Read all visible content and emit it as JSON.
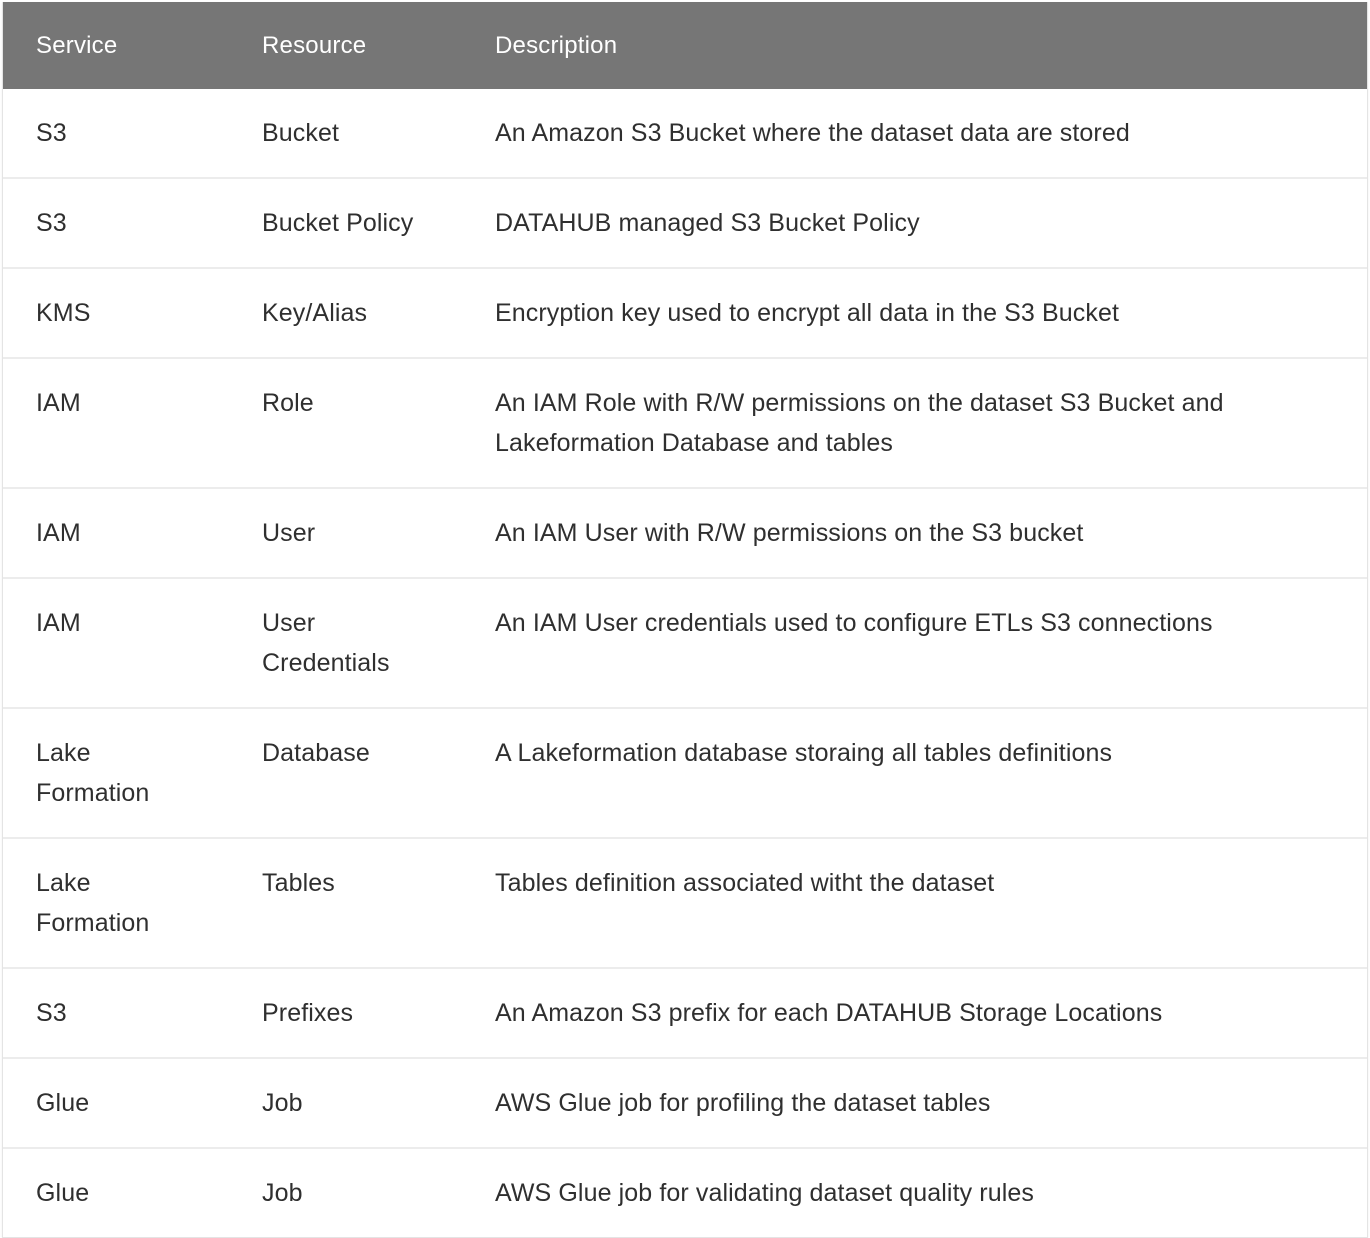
{
  "table": {
    "headers": {
      "service": "Service",
      "resource": "Resource",
      "description": "Description"
    },
    "rows": [
      {
        "service": "S3",
        "resource": "Bucket",
        "description": "An Amazon S3 Bucket where the dataset data are stored"
      },
      {
        "service": "S3",
        "resource": "Bucket Policy",
        "description": "DATAHUB managed S3 Bucket Policy"
      },
      {
        "service": "KMS",
        "resource": "Key/Alias",
        "description": "Encryption key used to encrypt all data in the S3 Bucket"
      },
      {
        "service": "IAM",
        "resource": "Role",
        "description": "An IAM Role with R/W permissions on the dataset S3 Bucket and Lakeformation Database and tables"
      },
      {
        "service": "IAM",
        "resource": "User",
        "description": "An IAM User with R/W permissions on the S3 bucket"
      },
      {
        "service": "IAM",
        "resource": "User Credentials",
        "description": "An IAM User credentials used to configure ETLs S3 connections"
      },
      {
        "service": "Lake Formation",
        "resource": "Database",
        "description": "A Lakeformation database storaing all tables definitions"
      },
      {
        "service": "Lake Formation",
        "resource": "Tables",
        "description": "Tables definition associated witht the dataset"
      },
      {
        "service": "S3",
        "resource": "Prefixes",
        "description": "An Amazon S3 prefix for each DATAHUB Storage Locations"
      },
      {
        "service": "Glue",
        "resource": "Job",
        "description": "AWS Glue job for profiling the dataset tables"
      },
      {
        "service": "Glue",
        "resource": "Job",
        "description": "AWS Glue job for validating dataset quality rules"
      }
    ]
  },
  "colors": {
    "header_background": "#767676",
    "header_text": "#ffffff",
    "row_divider": "#ececec",
    "body_text": "#2f2f2f"
  }
}
